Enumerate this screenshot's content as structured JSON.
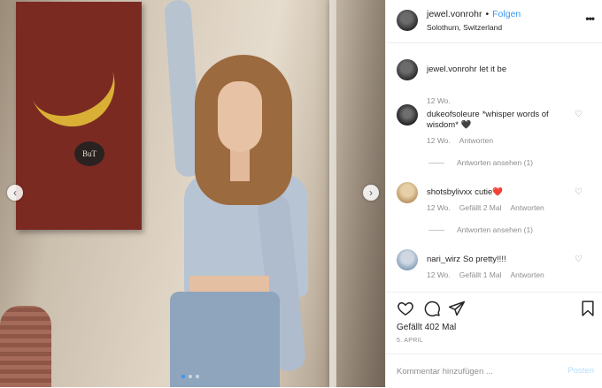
{
  "post": {
    "username": "jewel.vonrohr",
    "separator": "•",
    "follow_label": "Folgen",
    "location": "Solothurn, Switzerland",
    "more_icon": "more-options-icon",
    "more_glyph": "•••",
    "painting_tag": "BuT",
    "carousel": {
      "total": 3,
      "active": 0,
      "prev_glyph": "‹",
      "next_glyph": "›"
    }
  },
  "caption": {
    "username": "jewel.vonrohr",
    "text": "let it be",
    "time": "12 Wo."
  },
  "comments": [
    {
      "username": "dukeofsoleure",
      "text": "*whisper words of wisdom* 🖤",
      "time": "12 Wo.",
      "reply_label": "Antworten",
      "view_replies": "Antworten ansehen (1)"
    },
    {
      "username": "shotsbylivxx",
      "text": "cutie❤️",
      "time": "12 Wo.",
      "likes": "Gefällt 2 Mal",
      "reply_label": "Antworten",
      "view_replies": "Antworten ansehen (1)"
    },
    {
      "username": "nari_wirz",
      "text": "So pretty!!!!",
      "time": "12 Wo.",
      "likes": "Gefällt 1 Mal",
      "reply_label": "Antworten"
    }
  ],
  "actions": {
    "like_icon": "heart-icon",
    "comment_icon": "comment-icon",
    "share_icon": "share-icon",
    "save_icon": "bookmark-icon",
    "likes_text": "Gefällt 402 Mal",
    "date": "5. APRIL"
  },
  "add_comment": {
    "placeholder": "Kommentar hinzufügen ...",
    "post_label": "Posten"
  },
  "colors": {
    "link_blue": "#3897f0",
    "post_disabled": "#b2dffc",
    "muted": "#8e8e8e",
    "text": "#262626"
  }
}
